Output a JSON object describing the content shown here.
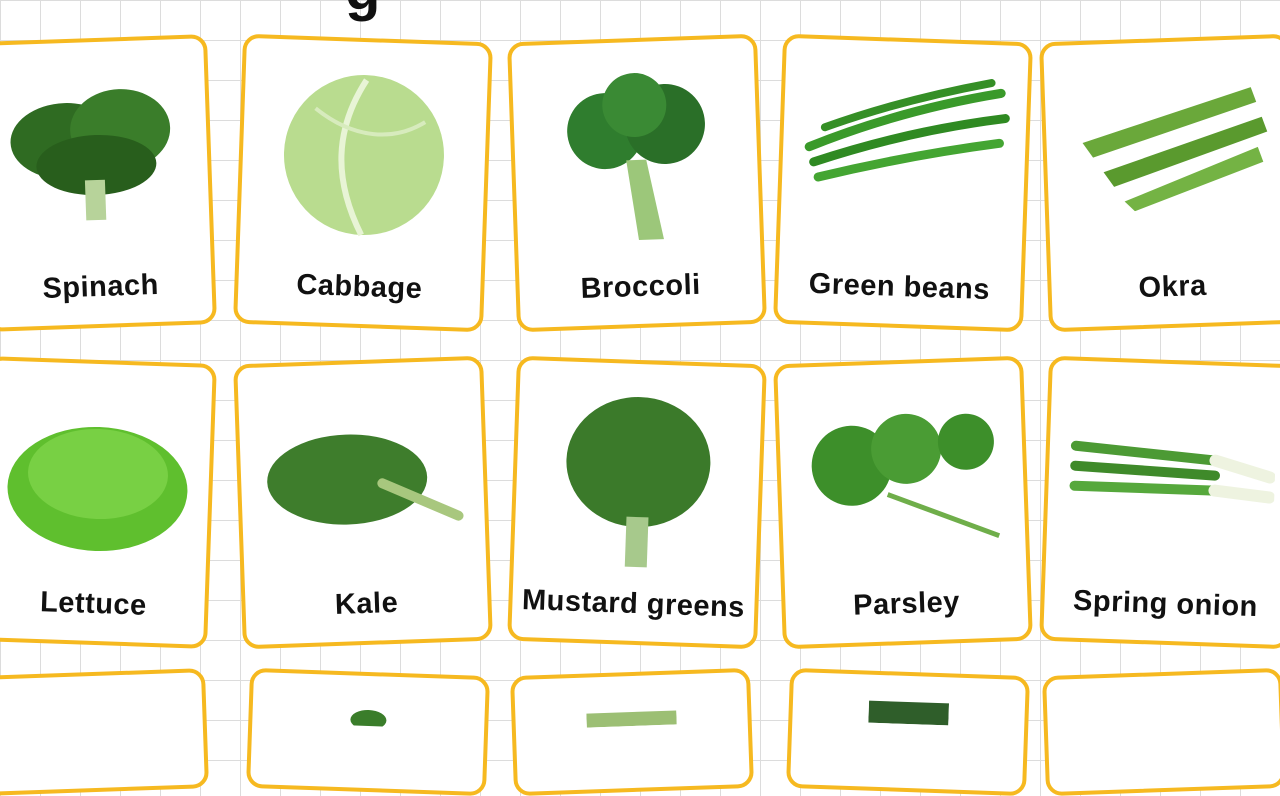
{
  "title_fragment": "g",
  "cards": [
    {
      "id": "spinach",
      "label": "Spinach",
      "icon": "spinach-icon",
      "color": "#2f6b22"
    },
    {
      "id": "cabbage",
      "label": "Cabbage",
      "icon": "cabbage-icon",
      "color": "#b9dc8f"
    },
    {
      "id": "broccoli",
      "label": "Broccoli",
      "icon": "broccoli-icon",
      "color": "#2f7d2e"
    },
    {
      "id": "green-beans",
      "label": "Green beans",
      "icon": "green-beans-icon",
      "color": "#3a9a2a"
    },
    {
      "id": "okra",
      "label": "Okra",
      "icon": "okra-icon",
      "color": "#6aa83a"
    },
    {
      "id": "lettuce",
      "label": "Lettuce",
      "icon": "lettuce-icon",
      "color": "#5fbf2e"
    },
    {
      "id": "kale",
      "label": "Kale",
      "icon": "kale-icon",
      "color": "#3e7d2c"
    },
    {
      "id": "mustard-greens",
      "label": "Mustard greens",
      "icon": "mustard-greens-icon",
      "color": "#3b7a2a"
    },
    {
      "id": "parsley",
      "label": "Parsley",
      "icon": "parsley-icon",
      "color": "#3d8f2a"
    },
    {
      "id": "spring-onion",
      "label": "Spring onion",
      "icon": "spring-onion-icon",
      "color": "#4c9a34"
    }
  ],
  "colors": {
    "card_border": "#f6b920",
    "grid": "#dcdcdc",
    "label_text": "#111111"
  }
}
